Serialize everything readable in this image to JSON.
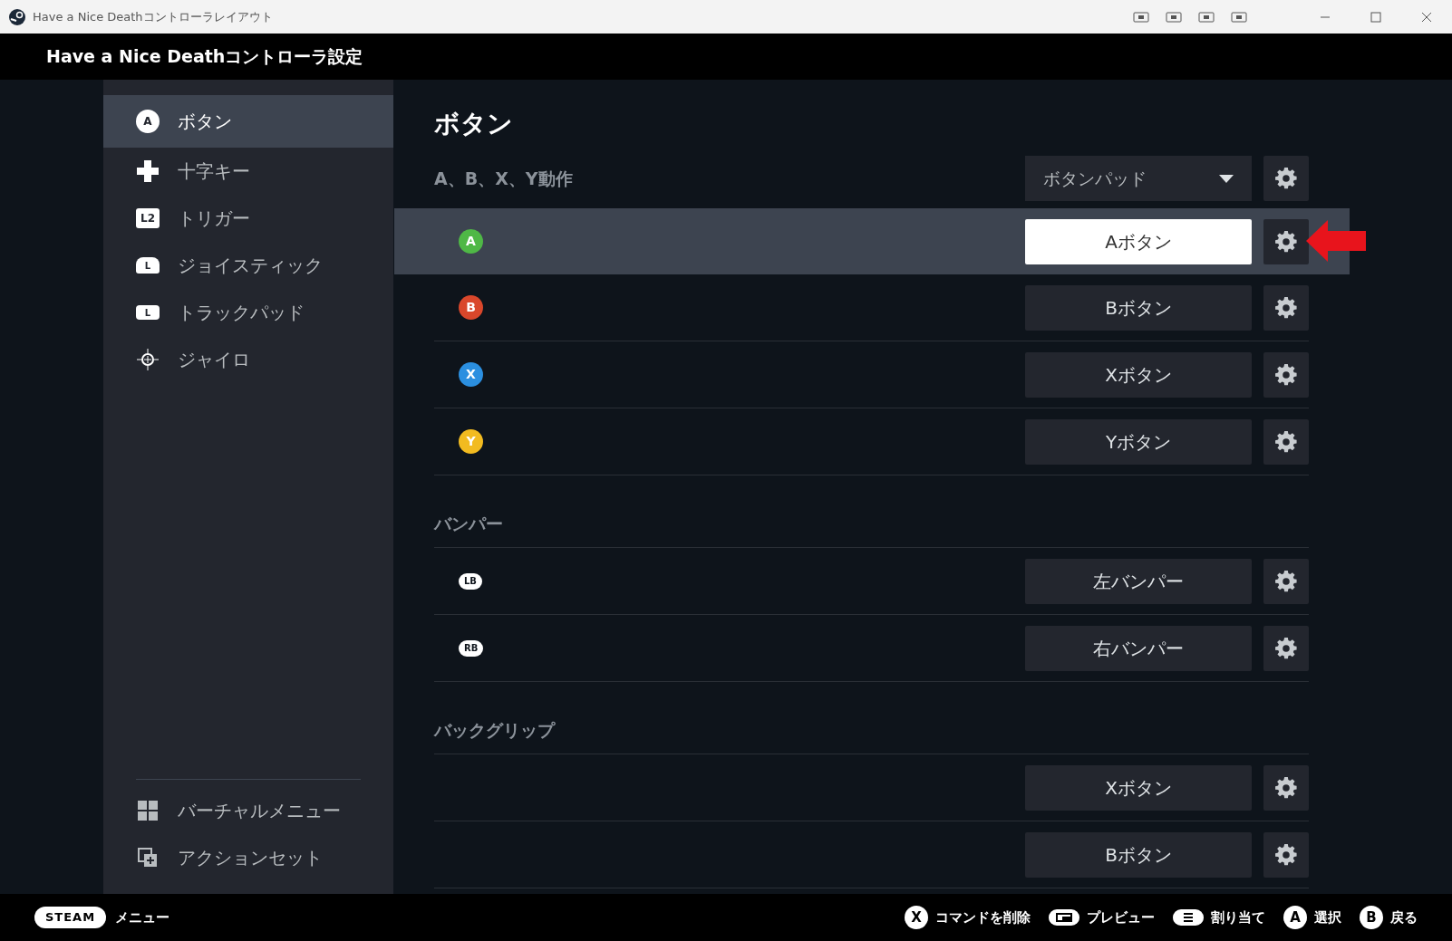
{
  "window": {
    "title": "Have a Nice Deathコントローラレイアウト"
  },
  "header": {
    "title": "Have a Nice Deathコントローラ設定"
  },
  "sidebar": {
    "items": [
      {
        "label": "ボタン",
        "kind": "circle",
        "glyph": "A",
        "selected": true
      },
      {
        "label": "十字キー",
        "kind": "dpad",
        "selected": false
      },
      {
        "label": "トリガー",
        "kind": "square",
        "glyph": "L2",
        "selected": false
      },
      {
        "label": "ジョイスティック",
        "kind": "stick",
        "glyph": "L",
        "selected": false
      },
      {
        "label": "トラックパッド",
        "kind": "pad",
        "glyph": "L",
        "selected": false
      },
      {
        "label": "ジャイロ",
        "kind": "gyro",
        "selected": false
      }
    ],
    "bottom_items": [
      {
        "label": "バーチャルメニュー",
        "kind": "grid",
        "selected": false
      },
      {
        "label": "アクションセット",
        "kind": "layers",
        "selected": false
      }
    ]
  },
  "main": {
    "title": "ボタン",
    "sections": [
      {
        "heading": "A、B、X、Y動作",
        "dropdown": "ボタンパッド",
        "rows": [
          {
            "badge": "A",
            "color": "#4fb846",
            "binding": "Aボタン",
            "selected": true
          },
          {
            "badge": "B",
            "color": "#d9472b",
            "binding": "Bボタン",
            "selected": false
          },
          {
            "badge": "X",
            "color": "#2b8fe0",
            "binding": "Xボタン",
            "selected": false
          },
          {
            "badge": "Y",
            "color": "#f2bb20",
            "binding": "Yボタン",
            "selected": false
          }
        ]
      },
      {
        "heading": "バンパー",
        "rows": [
          {
            "badge": "LB",
            "binding": "左バンパー",
            "selected": false
          },
          {
            "badge": "RB",
            "binding": "右バンパー",
            "selected": false
          }
        ]
      },
      {
        "heading": "バックグリップ",
        "rows": [
          {
            "binding": "Xボタン",
            "selected": false
          },
          {
            "binding": "Bボタン",
            "selected": false
          }
        ]
      }
    ]
  },
  "footer": {
    "steam": "STEAM",
    "menu": "メニュー",
    "hints": [
      {
        "kind": "letter",
        "glyph": "X",
        "label": "コマンドを削除"
      },
      {
        "kind": "view",
        "label": "プレビュー"
      },
      {
        "kind": "menu",
        "label": "割り当て"
      },
      {
        "kind": "letter",
        "glyph": "A",
        "label": "選択"
      },
      {
        "kind": "letter",
        "glyph": "B",
        "label": "戻る"
      }
    ]
  }
}
